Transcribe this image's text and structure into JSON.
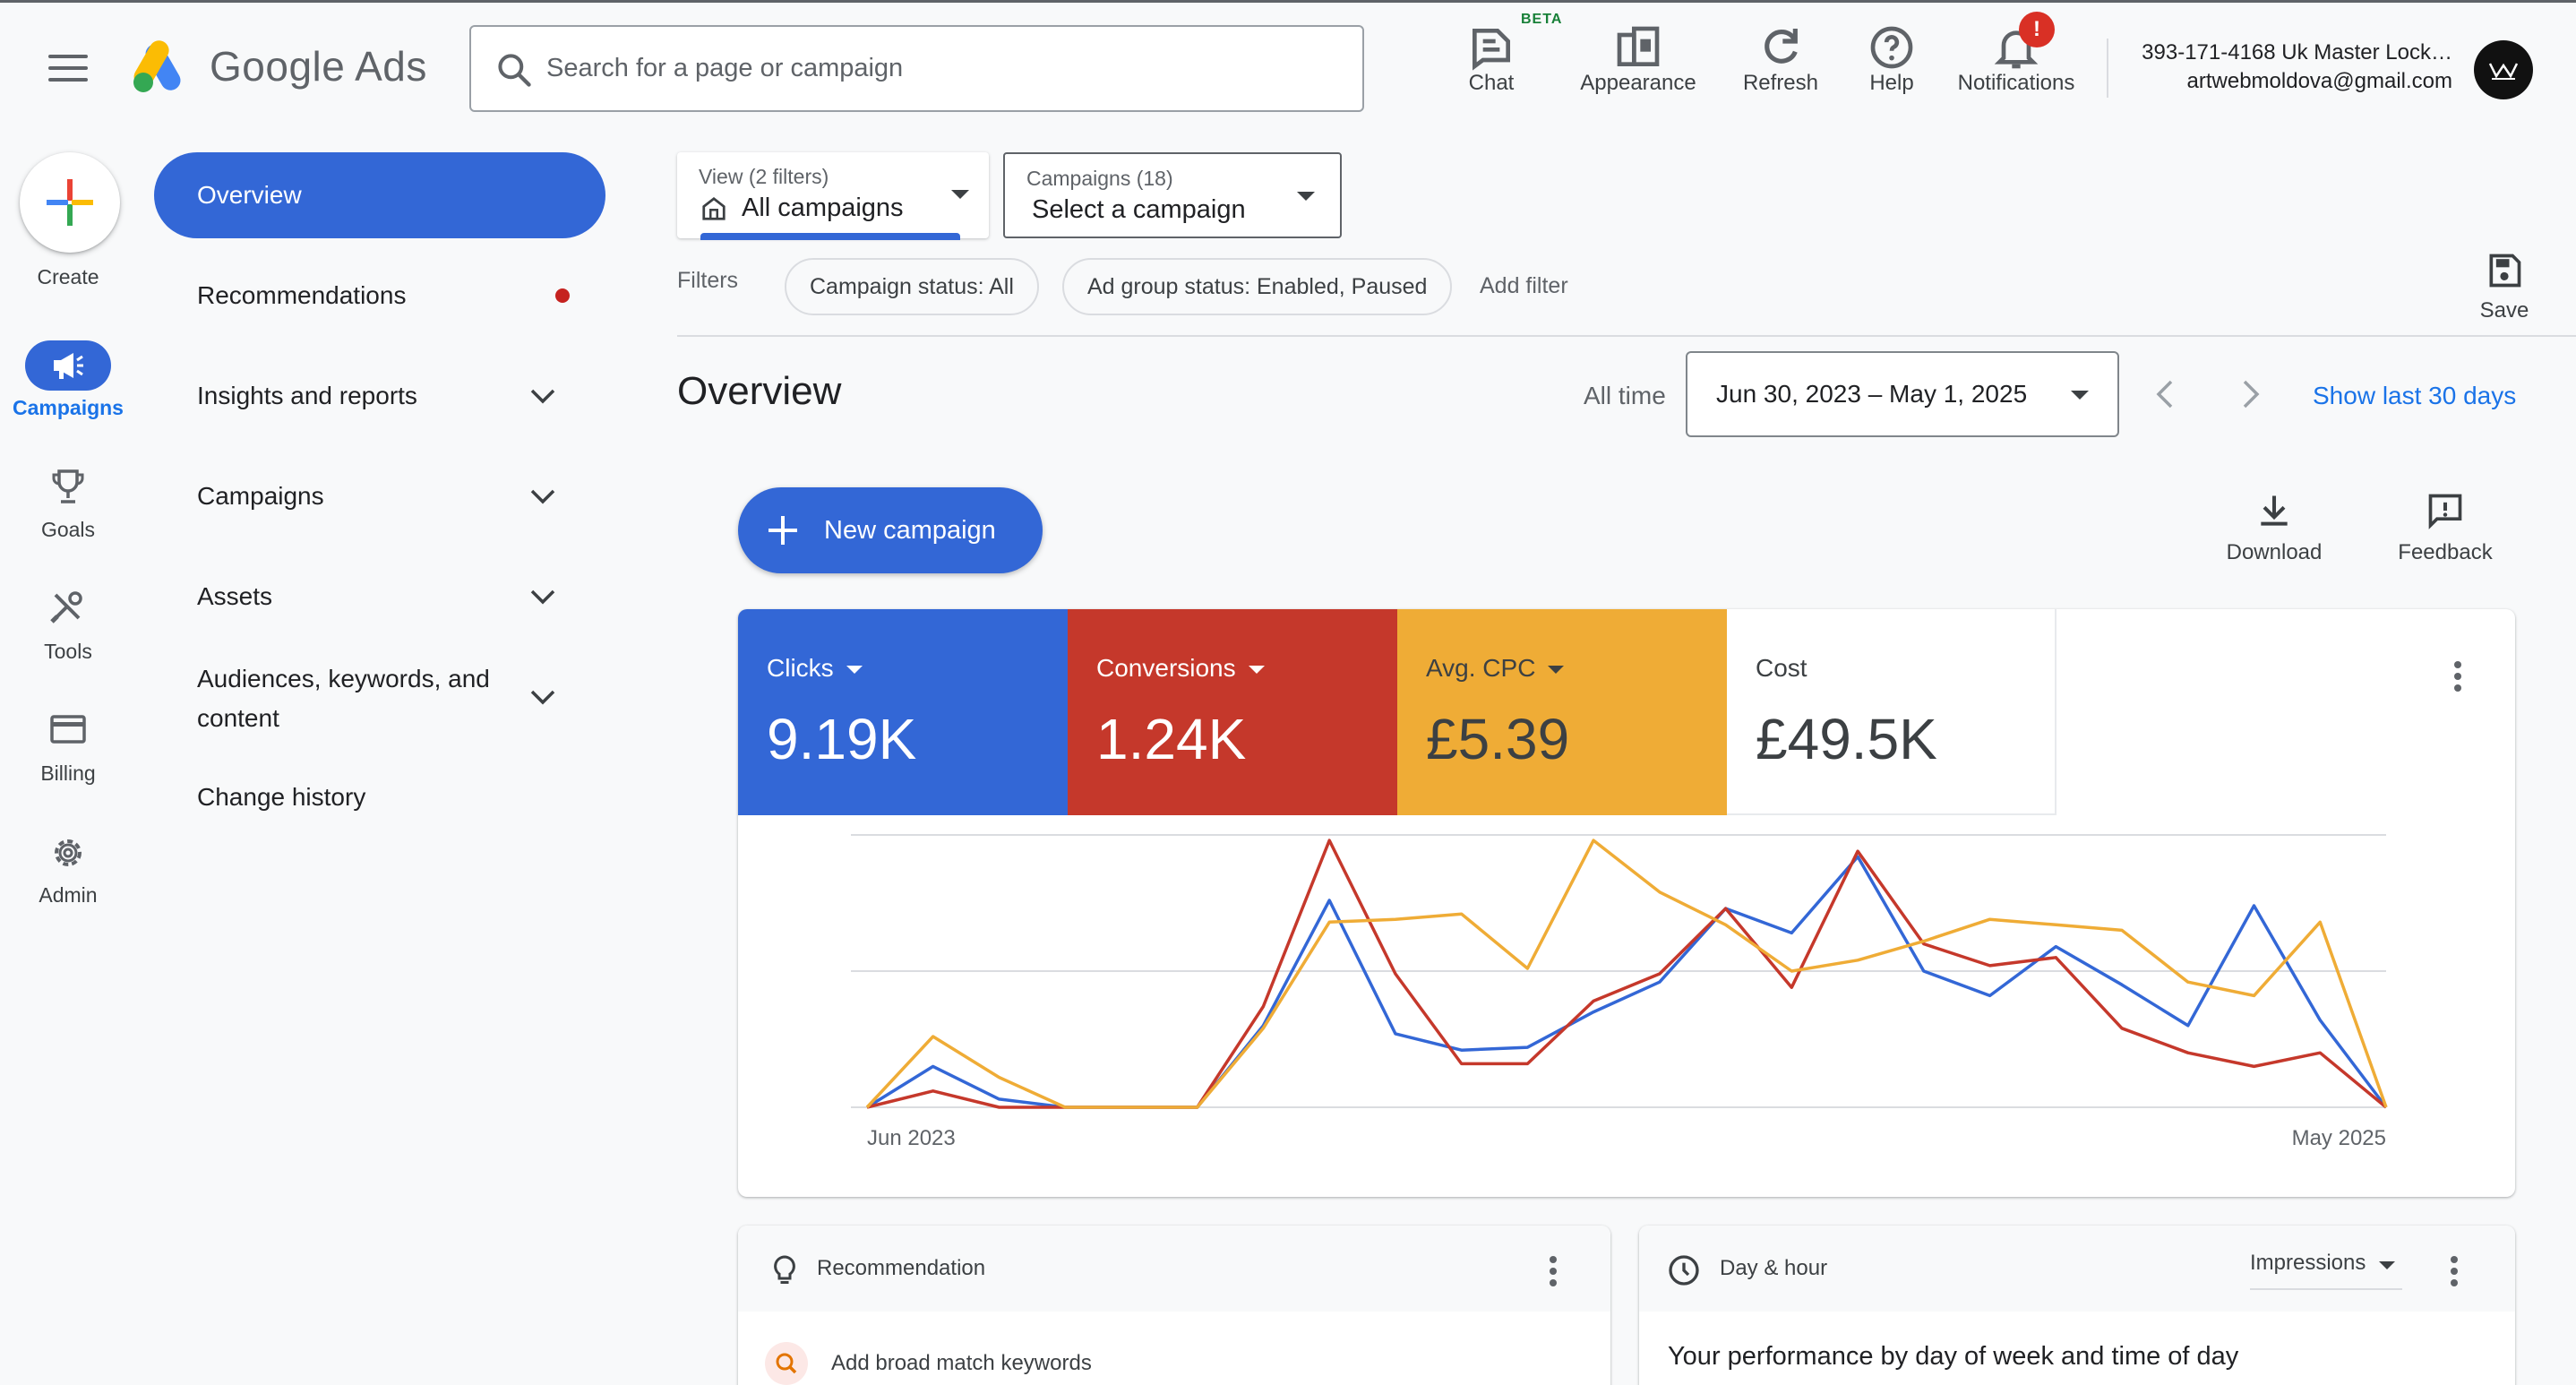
{
  "app": {
    "name": "Google Ads"
  },
  "search": {
    "placeholder": "Search for a page or campaign"
  },
  "toolbar": {
    "chat": "Chat",
    "beta": "BETA",
    "appearance": "Appearance",
    "refresh": "Refresh",
    "help": "Help",
    "notifications": "Notifications",
    "notifications_badge": "!"
  },
  "account": {
    "name": "393-171-4168 Uk Master Lock…",
    "email": "artwebmoldova@gmail.com"
  },
  "rail": {
    "create": "Create",
    "campaigns": "Campaigns",
    "goals": "Goals",
    "tools": "Tools",
    "billing": "Billing",
    "admin": "Admin"
  },
  "nav": {
    "overview": "Overview",
    "recommendations": "Recommendations",
    "insights": "Insights and reports",
    "campaigns": "Campaigns",
    "assets": "Assets",
    "audiences_line1": "Audiences, keywords, and",
    "audiences_line2": "content",
    "change_history": "Change history"
  },
  "view_select": {
    "label": "View (2 filters)",
    "value": "All campaigns"
  },
  "campaign_select": {
    "label": "Campaigns (18)",
    "value": "Select a campaign"
  },
  "filters": {
    "label": "Filters",
    "chips": [
      "Campaign status: All",
      "Ad group status: Enabled, Paused"
    ],
    "add": "Add filter",
    "save": "Save"
  },
  "overview": {
    "title": "Overview",
    "all_time": "All time",
    "date_range": "Jun 30, 2023 – May 1, 2025",
    "show_last": "Show last 30 days",
    "new_campaign": "New campaign",
    "download": "Download",
    "feedback": "Feedback"
  },
  "metrics": [
    {
      "name": "Clicks",
      "value": "9.19K",
      "color": "#3367d6",
      "text": "#ffffff",
      "dropdown": true
    },
    {
      "name": "Conversions",
      "value": "1.24K",
      "color": "#c5382b",
      "text": "#ffffff",
      "dropdown": true
    },
    {
      "name": "Avg. CPC",
      "value": "£5.39",
      "color": "#efac36",
      "text": "#3c4043",
      "dropdown": true
    },
    {
      "name": "Cost",
      "value": "£49.5K",
      "color": "#ffffff",
      "text": "#3c4043",
      "dropdown": false
    }
  ],
  "chart_data": {
    "type": "line",
    "x_start_label": "Jun 2023",
    "x_end_label": "May 2025",
    "ylim": [
      0,
      100
    ],
    "grid": true,
    "series": [
      {
        "color": "#3367d6",
        "values": [
          0,
          15,
          3,
          0,
          0,
          0,
          30,
          76,
          27,
          21,
          22,
          35,
          46,
          73,
          64,
          92,
          50,
          41,
          59,
          45,
          30,
          74,
          32,
          0
        ]
      },
      {
        "color": "#c5382b",
        "values": [
          0,
          6,
          0,
          0,
          0,
          0,
          37,
          98,
          49,
          16,
          16,
          39,
          49,
          73,
          44,
          94,
          60,
          52,
          55,
          29,
          20,
          15,
          20,
          0
        ]
      },
      {
        "color": "#efac36",
        "values": [
          0,
          26,
          11,
          0,
          0,
          0,
          29,
          68,
          69,
          71,
          51,
          98,
          79,
          67,
          50,
          54,
          61,
          69,
          67,
          65,
          46,
          41,
          68,
          0
        ]
      }
    ]
  },
  "recommendation_card": {
    "title": "Recommendation",
    "item": "Add broad match keywords"
  },
  "dayhour_card": {
    "title": "Day & hour",
    "metric": "Impressions",
    "subtitle": "Your performance by day of week and time of day"
  }
}
